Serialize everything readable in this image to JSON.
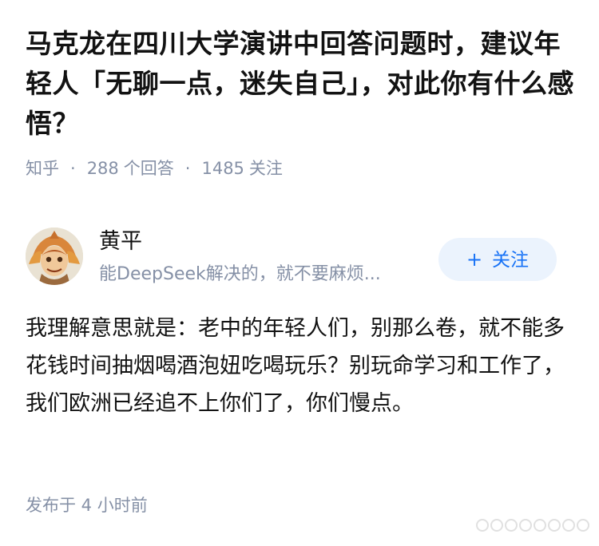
{
  "question": {
    "title": "马克龙在四川大学演讲中回答问题时，建议年轻人「无聊一点，迷失自己」，对此你有什么感悟？",
    "source": "知乎",
    "answer_count": "288",
    "answer_label": "个回答",
    "follower_count": "1485",
    "follower_label": "关注"
  },
  "answer": {
    "author_name": "黄平",
    "author_bio": "能DeepSeek解决的，就不要麻烦...",
    "follow_button": "关注",
    "content": "我理解意思就是：老中的年轻人们，别那么卷，就不能多花钱时间抽烟喝酒泡妞吃喝玩乐？别玩命学习和工作了，我们欧洲已经追不上你们了，你们慢点。",
    "published": "发布于  4 小时前"
  },
  "icons": {
    "plus": "plus-icon",
    "avatar": "avatar-image",
    "watermark": "watermark-dots"
  },
  "colors": {
    "accent": "#1772f6",
    "accent_bg": "#ebf3fd",
    "meta_text": "#8590a6",
    "body_text": "#121212"
  }
}
